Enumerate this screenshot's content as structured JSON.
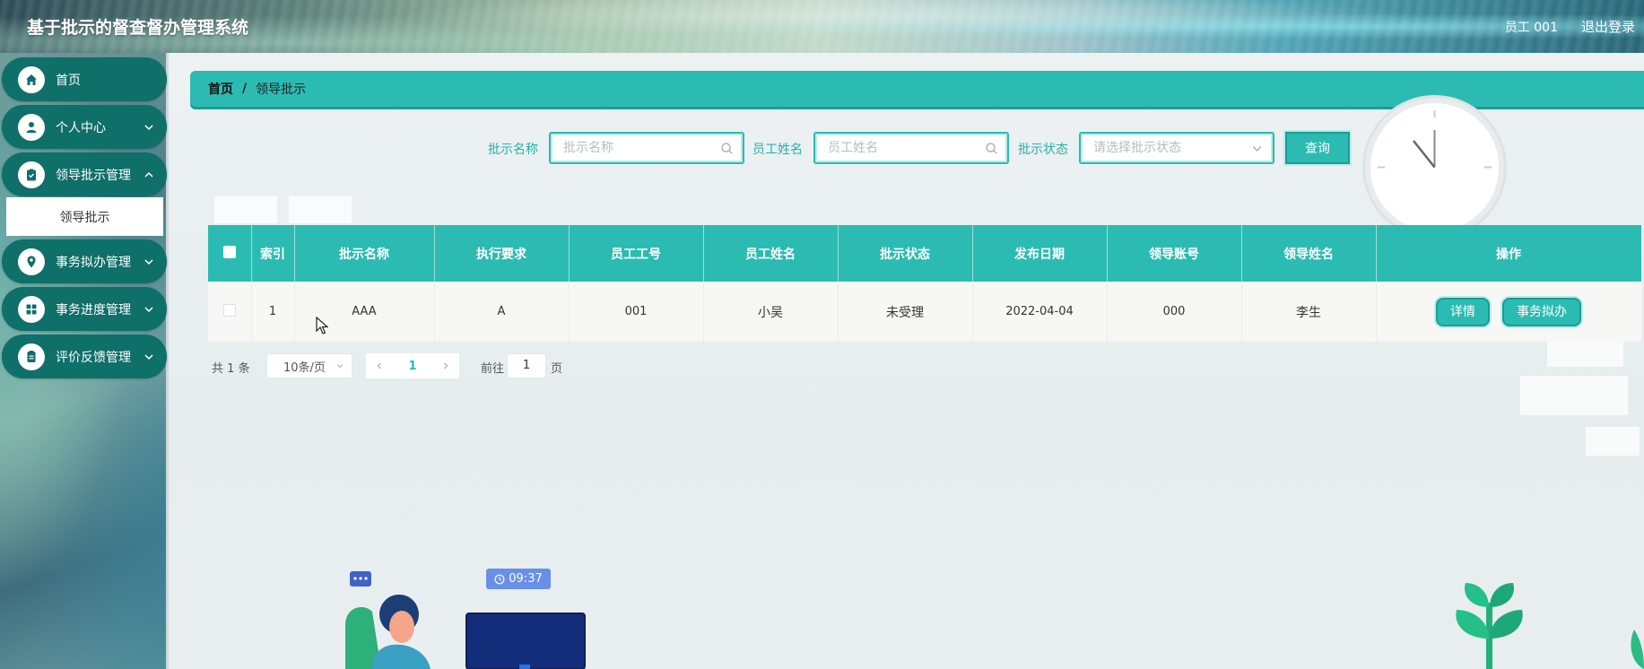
{
  "header": {
    "app_title": "基于批示的督查督办管理系统",
    "user_label": "员工 001",
    "logout_label": "退出登录"
  },
  "sidebar": {
    "items": [
      {
        "label": "首页",
        "icon": "home-icon"
      },
      {
        "label": "个人中心",
        "icon": "user-icon"
      },
      {
        "label": "领导批示管理",
        "icon": "clipboard-icon"
      },
      {
        "label": "事务拟办管理",
        "icon": "location-icon"
      },
      {
        "label": "事务进度管理",
        "icon": "grid-icon"
      },
      {
        "label": "评价反馈管理",
        "icon": "document-icon"
      }
    ],
    "active_submenu": "领导批示"
  },
  "breadcrumb": {
    "home": "首页",
    "separator": "/",
    "current": "领导批示"
  },
  "search": {
    "fields": [
      {
        "label": "批示名称",
        "placeholder": "批示名称",
        "value": ""
      },
      {
        "label": "员工姓名",
        "placeholder": "员工姓名",
        "value": ""
      },
      {
        "label": "批示状态",
        "placeholder": "请选择批示状态",
        "value": ""
      }
    ],
    "query_button": "查询"
  },
  "table": {
    "columns": [
      "索引",
      "批示名称",
      "执行要求",
      "员工工号",
      "员工姓名",
      "批示状态",
      "发布日期",
      "领导账号",
      "领导姓名",
      "操作"
    ],
    "rows": [
      {
        "index": "1",
        "name": "AAA",
        "requirement": "A",
        "emp_no": "001",
        "emp_name": "小吴",
        "status": "未受理",
        "date": "2022-04-04",
        "leader_account": "000",
        "leader_name": "李生",
        "actions": [
          "详情",
          "事务拟办"
        ]
      }
    ]
  },
  "pagination": {
    "total_prefix": "共",
    "total": "1",
    "total_suffix": "条",
    "page_size": "10条/页",
    "current_page": "1",
    "goto_label": "前往",
    "goto_value": "1",
    "page_suffix": "页"
  },
  "illustration": {
    "time_badge": "09:37"
  },
  "colors": {
    "accent": "#2bbbb2",
    "sidebar_item": "#0f6f69"
  }
}
